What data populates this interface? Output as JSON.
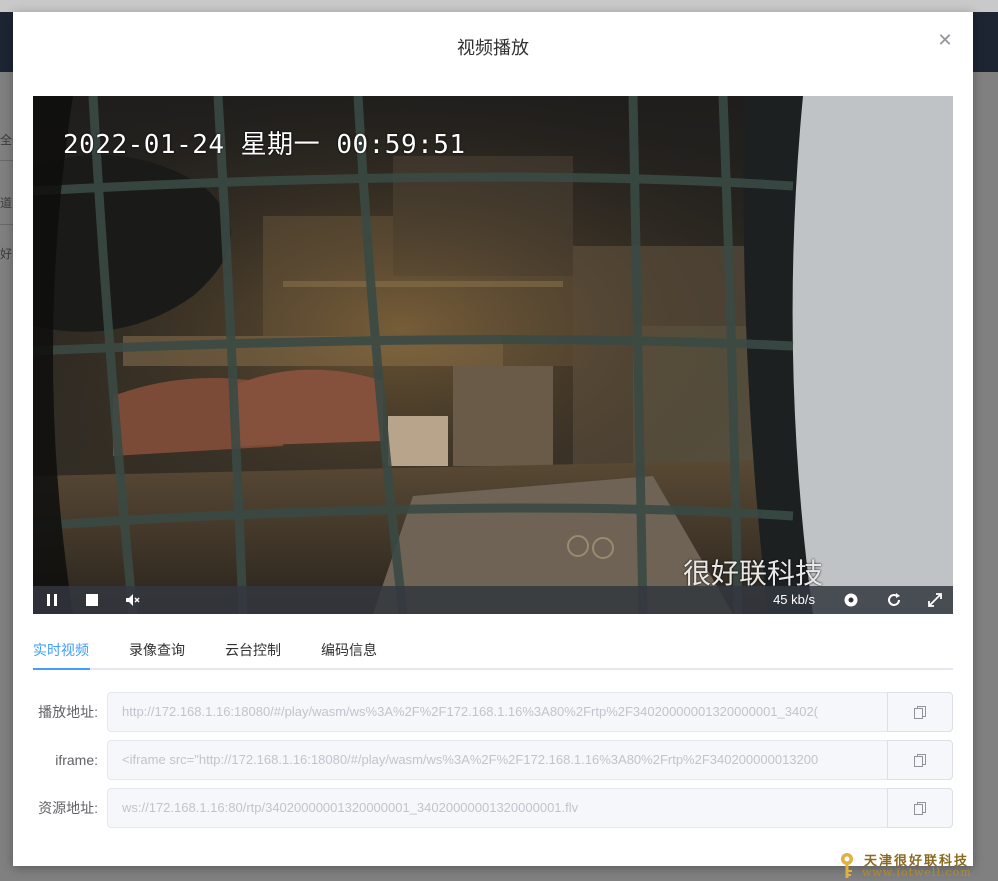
{
  "background": {
    "fragments": [
      "全部",
      "道",
      "好"
    ]
  },
  "dialog": {
    "title": "视频播放"
  },
  "video": {
    "osd_timestamp": "2022-01-24 星期一 00:59:51",
    "osd_brand": "很好联科技",
    "controls": {
      "speed": "45 kb/s",
      "icons": [
        "pause-icon",
        "stop-icon",
        "mute-icon",
        "screenshot-icon",
        "refresh-icon",
        "fullscreen-icon"
      ]
    }
  },
  "tabs": [
    {
      "label": "实时视频",
      "active": true
    },
    {
      "label": "录像查询",
      "active": false
    },
    {
      "label": "云台控制",
      "active": false
    },
    {
      "label": "编码信息",
      "active": false
    }
  ],
  "fields": [
    {
      "label": "播放地址:",
      "value": "http://172.168.1.16:18080/#/play/wasm/ws%3A%2F%2F172.168.1.16%3A80%2Frtp%2F34020000001320000001_3402("
    },
    {
      "label": "iframe:",
      "value": "<iframe src=\"http://172.168.1.16:18080/#/play/wasm/ws%3A%2F%2F172.168.1.16%3A80%2Frtp%2F340200000013200"
    },
    {
      "label": "资源地址:",
      "value": "ws://172.168.1.16:80/rtp/34020000001320000001_34020000001320000001.flv"
    }
  ],
  "watermark": {
    "line1": "天津很好联科技",
    "line2": "www.iotwell.com"
  },
  "colors": {
    "accent": "#409eff",
    "overlay": "#808080",
    "header": "#1d2533"
  }
}
